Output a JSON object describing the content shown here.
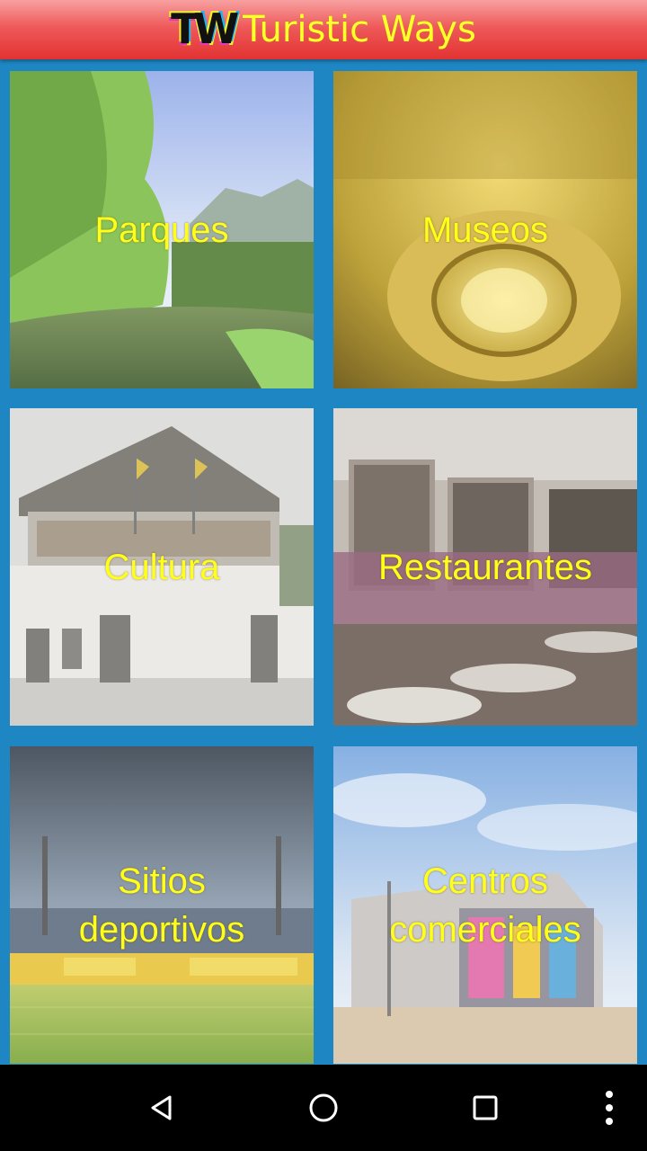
{
  "app_bar": {
    "logo_text": "TW",
    "title": "Turistic Ways"
  },
  "categories": [
    {
      "label": "Parques"
    },
    {
      "label": "Museos"
    },
    {
      "label": "Cultura"
    },
    {
      "label": "Restaurantes"
    },
    {
      "label": "Sitios\ndeportivos"
    },
    {
      "label": "Centros\ncomerciales"
    }
  ],
  "nav": {
    "icons": [
      "back-icon",
      "home-icon",
      "recents-icon",
      "overflow-menu-icon"
    ]
  },
  "colors": {
    "app_bar_red": "#e23232",
    "title_yellow": "#ffff2e",
    "background_blue": "#1f86c4",
    "label_yellow": "#ffff1a"
  }
}
